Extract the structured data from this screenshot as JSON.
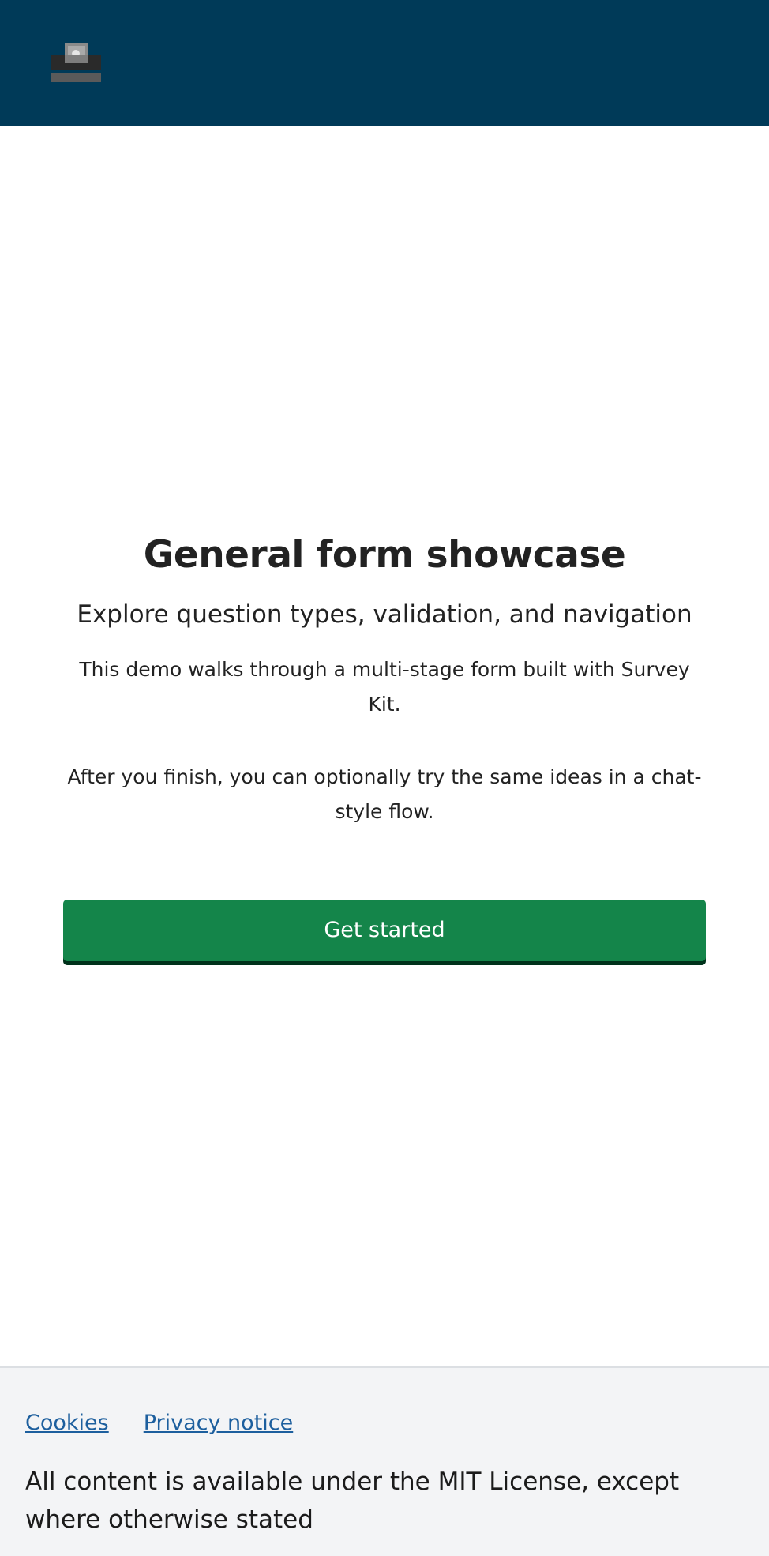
{
  "header": {
    "logo_icon": "ballot-box-icon",
    "background_color": "#003a58"
  },
  "main": {
    "title": "General form showcase",
    "subtitle": "Explore question types, validation, and navigation",
    "paragraphs": [
      "This demo walks through a multi-stage form built with Survey Kit.",
      "After you finish, you can optionally try the same ideas in a chat-style flow."
    ],
    "cta_label": "Get started",
    "cta_color": "#14854a"
  },
  "footer": {
    "links": [
      {
        "label": "Cookies"
      },
      {
        "label": "Privacy notice"
      }
    ],
    "license_text": "All content is available under the MIT License, except where otherwise stated",
    "link_color": "#1d5f9e"
  }
}
